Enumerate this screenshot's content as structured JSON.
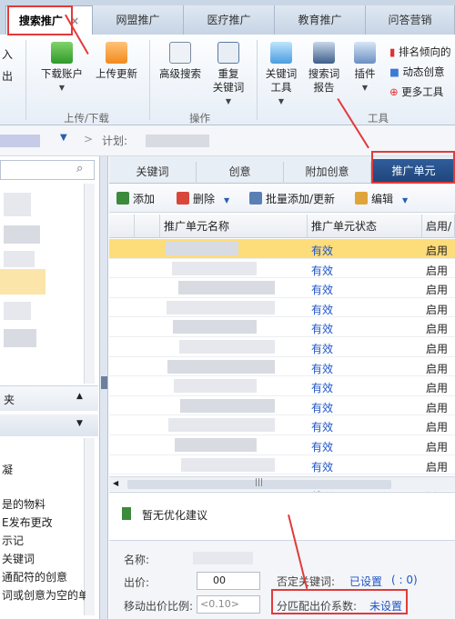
{
  "top_tabs": [
    {
      "label": "搜索推广",
      "close": "×"
    },
    {
      "label": "网盟推广"
    },
    {
      "label": "医疗推广"
    },
    {
      "label": "教育推广"
    },
    {
      "label": "问答营销"
    }
  ],
  "ribbon": {
    "left_partial": [
      "入",
      "出"
    ],
    "download_account": "下载账户",
    "upload_update": "上传更新",
    "group_upload": "上传/下载",
    "advanced_search": "高级搜索",
    "duplicate_keyword_1": "重复",
    "duplicate_keyword_2": "关键词",
    "group_operation": "操作",
    "keyword_tool_1": "关键词",
    "keyword_tool_2": "工具",
    "search_report_1": "搜索词",
    "search_report_2": "报告",
    "plugin": "插件",
    "group_tools": "工具",
    "rank_direction": "排名倾向的",
    "dynamic_creative": "动态创意",
    "more_tools": "更多工具"
  },
  "breadcrumb": {
    "separator": ">",
    "plan_label": "计划:"
  },
  "left_panel": {
    "folder_label": "夹",
    "items": [
      "凝",
      "是的物料",
      "E发布更改",
      "示记",
      "关键词",
      "通配符的创意",
      "词或创意为空的单"
    ]
  },
  "sub_tabs": [
    "关键词",
    "创意",
    "附加创意",
    "推广单元"
  ],
  "toolbar": {
    "add": "添加",
    "delete": "删除",
    "batch": "批量添加/更新",
    "edit": "编辑"
  },
  "grid": {
    "headers": [
      "推广单元名称",
      "推广单元状态",
      "启用/暂"
    ],
    "rows": [
      {
        "status": "有效",
        "enable": "启用"
      },
      {
        "status": "有效",
        "enable": "启用"
      },
      {
        "status": "有效",
        "enable": "启用"
      },
      {
        "status": "有效",
        "enable": "启用"
      },
      {
        "status": "有效",
        "enable": "启用"
      },
      {
        "status": "有效",
        "enable": "启用"
      },
      {
        "status": "有效",
        "enable": "启用"
      },
      {
        "status": "有效",
        "enable": "启用"
      },
      {
        "status": "有效",
        "enable": "启用"
      },
      {
        "status": "有效",
        "enable": "启用"
      },
      {
        "status": "有效",
        "enable": "启用"
      },
      {
        "status": "有效",
        "enable": "启用"
      },
      {
        "status": "有效",
        "enable": "启用"
      }
    ]
  },
  "scroll_grip": "|||",
  "suggestion": "暂无优化建议",
  "detail": {
    "name_label": "名称:",
    "bid_label": "出价:",
    "bid_value": "00",
    "mobile_ratio_label": "移动出价比例:",
    "mobile_ratio_placeholder": "<0.10>",
    "negative_keyword_label": "否定关键词:",
    "negative_keyword_value": "已设置",
    "negative_keyword_count": "( : 0)",
    "match_bid_label": "分匹配出价系数:",
    "match_bid_value": "未设置"
  },
  "colors": {
    "accent_red": "#e23a3a",
    "link_blue": "#1f55c7",
    "selected_row": "#fddc7a"
  }
}
